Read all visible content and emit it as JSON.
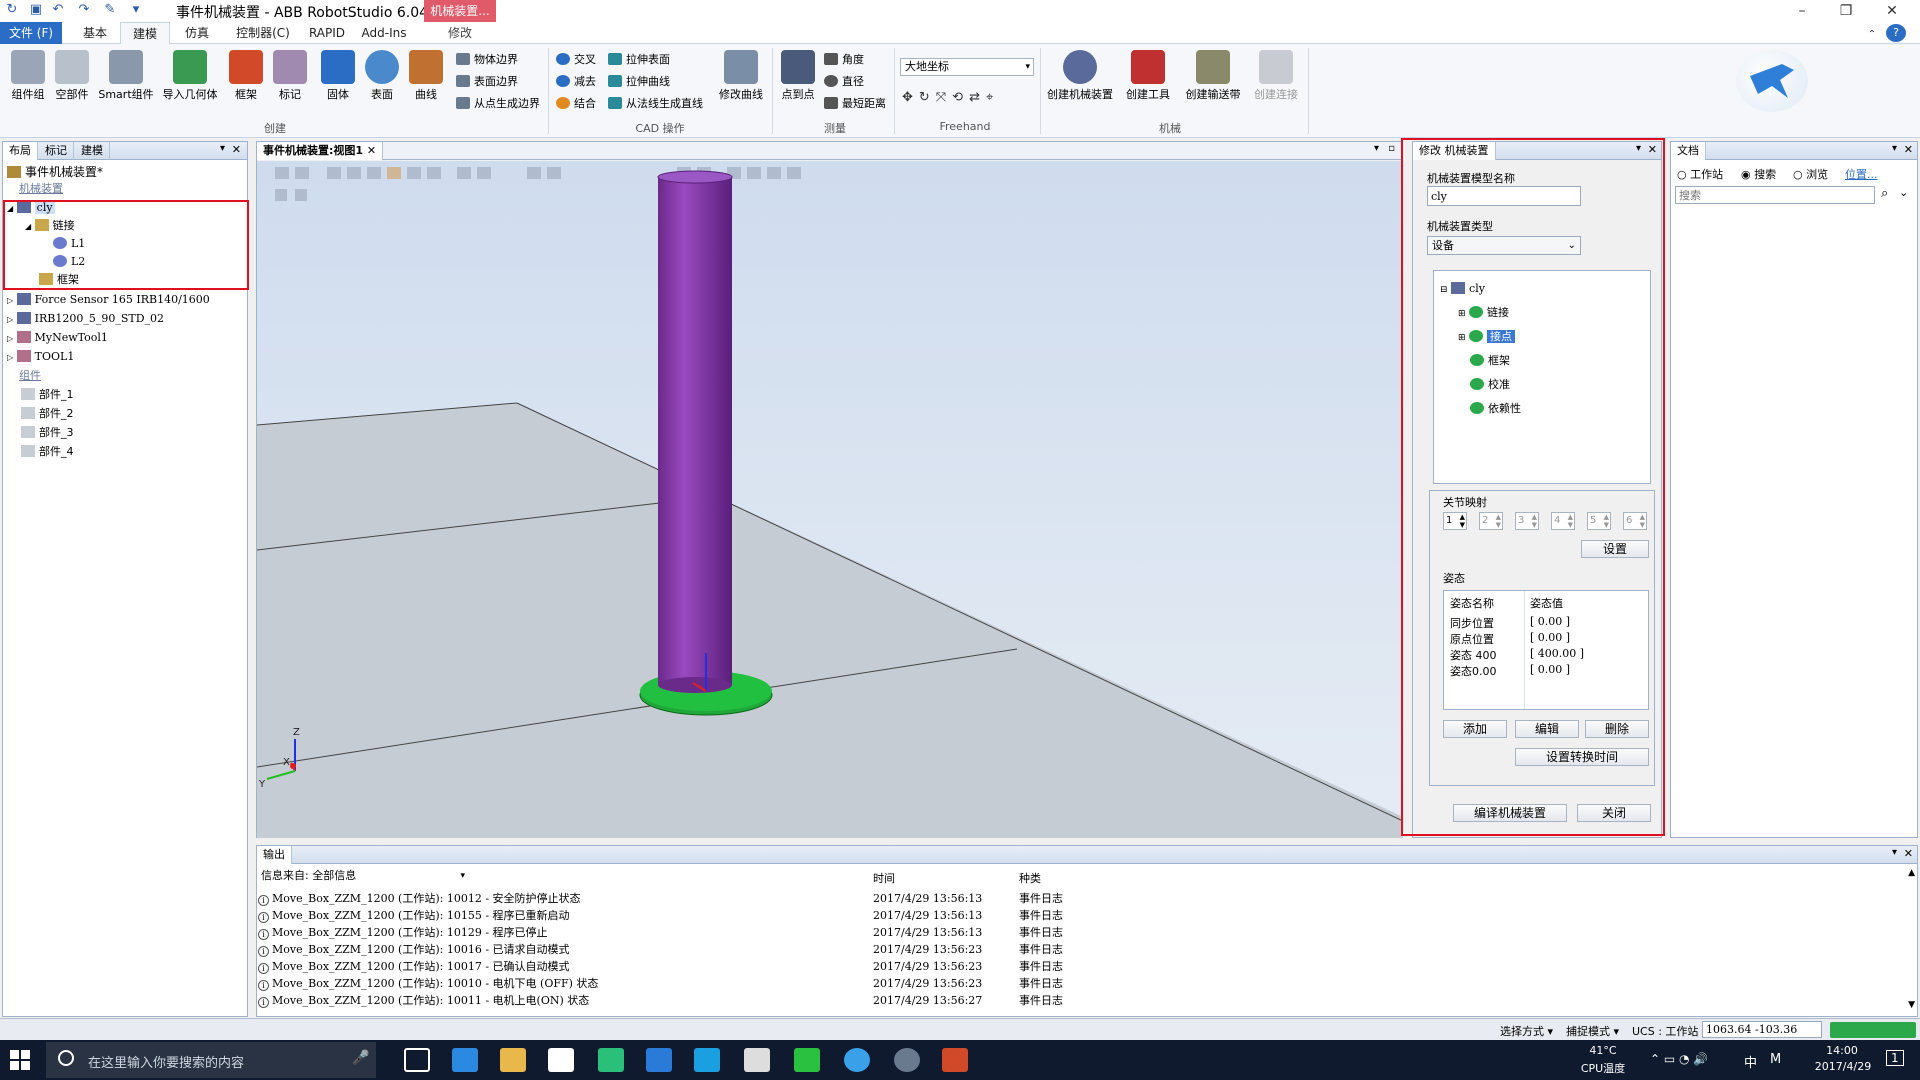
{
  "window": {
    "title": "事件机械装置 - ABB RobotStudio 6.04...",
    "context_label": "机械装置...",
    "context_tab": "修改"
  },
  "ribbon_tabs": [
    "文件 (F)",
    "基本",
    "建模",
    "仿真",
    "控制器(C)",
    "RAPID",
    "Add-Ins"
  ],
  "ribbon": {
    "create": {
      "buttons": [
        "组件组",
        "空部件",
        "Smart组件",
        "导入几何体",
        "框架",
        "标记",
        "固体",
        "表面",
        "曲线"
      ],
      "small": [
        "物体边界",
        "表面边界",
        "从点生成边界"
      ],
      "label": "创建"
    },
    "cad": {
      "small_a": [
        "交叉",
        "减去",
        "结合"
      ],
      "small_b": [
        "拉伸表面",
        "拉伸曲线",
        "从法线生成直线"
      ],
      "button": "修改曲线",
      "label": "CAD 操作"
    },
    "measure": {
      "button": "点到点",
      "small": [
        "角度",
        "直径",
        "最短距离"
      ],
      "label": "测量"
    },
    "freehand": {
      "dropdown": "大地坐标",
      "label": "Freehand"
    },
    "mech": {
      "buttons": [
        "创建机械装置",
        "创建工具",
        "创建输送带",
        "创建连接"
      ],
      "label": "机械"
    }
  },
  "left_panel": {
    "tabs": [
      "布局",
      "标记",
      "建模"
    ],
    "root": "事件机械装置*",
    "mechanism_header": "机械装置",
    "mechanism": {
      "name": "cly",
      "links_label": "链接",
      "links": [
        "L1",
        "L2"
      ],
      "frame": "框架"
    },
    "others": [
      "Force Sensor 165 IRB140/1600",
      "IRB1200_5_90_STD_02",
      "MyNewTool1",
      "TOOL1"
    ],
    "components_header": "组件",
    "parts": [
      "部件_1",
      "部件_2",
      "部件_3",
      "部件_4"
    ]
  },
  "viewport": {
    "tab": "事件机械装置:视图1",
    "axes": {
      "z": "Z",
      "x": "X",
      "y": "Y"
    }
  },
  "modify_panel": {
    "title": "修改 机械装置",
    "model_name_label": "机械装置模型名称",
    "model_name_value": "cly",
    "type_label": "机械装置类型",
    "type_value": "设备",
    "tree": {
      "root": "cly",
      "items": [
        "链接",
        "接点",
        "框架",
        "校准",
        "依赖性"
      ],
      "selected": "接点"
    },
    "joint_mapping_label": "关节映射",
    "joint_values": [
      "1",
      "2",
      "3",
      "4",
      "5",
      "6"
    ],
    "set_button": "设置",
    "pose_label": "姿态",
    "pose_columns": [
      "姿态名称",
      "姿态值"
    ],
    "poses": [
      {
        "name": "同步位置",
        "value": "[ 0.00 ]"
      },
      {
        "name": "原点位置",
        "value": "[ 0.00 ]"
      },
      {
        "name": "姿态 400",
        "value": "[ 400.00 ]"
      },
      {
        "name": "姿态0.00",
        "value": "[ 0.00 ]"
      }
    ],
    "add_button": "添加",
    "edit_button": "编辑",
    "delete_button": "删除",
    "transition_button": "设置转换时间",
    "compile_button": "编译机械装置",
    "close_button": "关闭"
  },
  "doc_panel": {
    "title": "文档",
    "radio_workstation": "工作站",
    "radio_search": "搜索",
    "radio_browse": "浏览",
    "location_link": "位置...",
    "search_placeholder": "搜索"
  },
  "output": {
    "title": "输出",
    "source_label": "信息来自: 全部信息",
    "time_header": "时间",
    "type_header": "种类",
    "rows": [
      {
        "msg": "Move_Box_ZZM_1200 (工作站): 10012 - 安全防护停止状态",
        "time": "2017/4/29 13:56:13",
        "type": "事件日志"
      },
      {
        "msg": "Move_Box_ZZM_1200 (工作站): 10155 - 程序已重新启动",
        "time": "2017/4/29 13:56:13",
        "type": "事件日志"
      },
      {
        "msg": "Move_Box_ZZM_1200 (工作站): 10129 - 程序已停止",
        "time": "2017/4/29 13:56:13",
        "type": "事件日志"
      },
      {
        "msg": "Move_Box_ZZM_1200 (工作站): 10016 - 已请求自动模式",
        "time": "2017/4/29 13:56:23",
        "type": "事件日志"
      },
      {
        "msg": "Move_Box_ZZM_1200 (工作站): 10017 - 已确认自动模式",
        "time": "2017/4/29 13:56:23",
        "type": "事件日志"
      },
      {
        "msg": "Move_Box_ZZM_1200 (工作站): 10010 - 电机下电 (OFF) 状态",
        "time": "2017/4/29 13:56:23",
        "type": "事件日志"
      },
      {
        "msg": "Move_Box_ZZM_1200 (工作站): 10011 - 电机上电(ON) 状态",
        "time": "2017/4/29 13:56:27",
        "type": "事件日志"
      }
    ]
  },
  "statusbar": {
    "select_mode": "选择方式",
    "snap_mode": "捕捉模式",
    "ucs": "UCS : 工作站",
    "coords": "1063.64  -103.36"
  },
  "taskbar": {
    "search_placeholder": "在这里输入你要搜索的内容",
    "temp": "41°C",
    "cpu": "CPU温度",
    "ime": "中",
    "time": "14:00",
    "date": "2017/4/29",
    "notif": "1"
  }
}
